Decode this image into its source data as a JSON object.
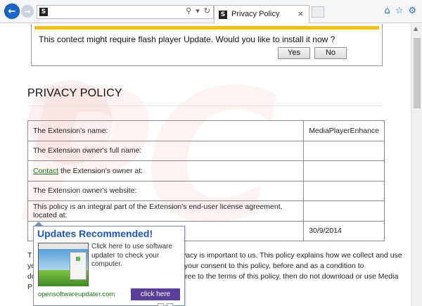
{
  "browser": {
    "favicon_letter": "S",
    "tab": {
      "title": "Privacy Policy",
      "close": "×"
    },
    "address_icons": [
      "⚲",
      "▾",
      "↻"
    ],
    "tools": [
      "⌂",
      "☆",
      "⚙"
    ]
  },
  "flash_prompt": {
    "message": "This contect might require flash player Update. Would you like to install it now ?",
    "yes_label": "Yes",
    "no_label": "No"
  },
  "watermark": "PC",
  "policy": {
    "title": "PRIVACY POLICY",
    "rows": [
      {
        "label": "The Extension's name:",
        "value": "MediaPlayerEnhance"
      },
      {
        "label": "The Extension owner's full name:",
        "value": ""
      },
      {
        "label_link": "Contact",
        "label": " the Extension's owner at:",
        "value": ""
      },
      {
        "label": "The Extension owner's website:",
        "value": ""
      },
      {
        "label": "This policy is an integral part of the Extension's end-user license agreement, located at:",
        "value": ""
      },
      {
        "label": "",
        "value": "30/9/2014"
      }
    ],
    "para_lines": [
      {
        "lead": "T",
        "text": "vacy is important to us. This policy explains how we collect and use"
      },
      {
        "lead": "yo",
        "text": "your consent to this policy, before and as a condition to"
      },
      {
        "lead": "do",
        "text": "ree to the terms of this policy, then do not download or use Media"
      },
      {
        "lead": "P",
        "text": ""
      }
    ]
  },
  "popup": {
    "title": "Updates Recommended!",
    "text": "Click here to use software updater to check your computer.",
    "domain": "opensoftwareupdater.com",
    "button": "click here"
  }
}
